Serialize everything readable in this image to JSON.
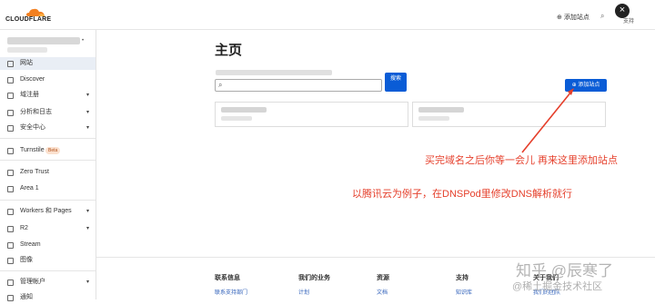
{
  "header": {
    "logo_text": "CLOUDFLARE",
    "add_site_label": "添加站点",
    "search_icon": "search-icon",
    "support_label": "支持",
    "close_icon": "close-icon"
  },
  "sidebar": {
    "items": [
      {
        "label": "网站",
        "icon": "website-icon",
        "caret": "",
        "active": true
      },
      {
        "label": "Discover",
        "icon": "discover-icon",
        "caret": ""
      },
      {
        "label": "域注册",
        "icon": "globe-icon",
        "caret": "▾"
      },
      {
        "label": "分析和日志",
        "icon": "analytics-icon",
        "caret": "▾"
      },
      {
        "label": "安全中心",
        "icon": "shield-icon",
        "caret": "▾"
      },
      {
        "label": "Turnstile",
        "icon": "turnstile-icon",
        "caret": "",
        "badge": "Beta"
      },
      {
        "label": "Zero Trust",
        "icon": "zero-trust-icon",
        "caret": ""
      },
      {
        "label": "Area 1",
        "icon": "area1-icon",
        "caret": ""
      },
      {
        "label": "Workers 和 Pages",
        "icon": "workers-icon",
        "caret": "▾"
      },
      {
        "label": "R2",
        "icon": "r2-icon",
        "caret": "▾"
      },
      {
        "label": "Stream",
        "icon": "stream-icon",
        "caret": ""
      },
      {
        "label": "图像",
        "icon": "images-icon",
        "caret": ""
      },
      {
        "label": "管理帐户",
        "icon": "settings-icon",
        "caret": "▾"
      },
      {
        "label": "通知",
        "icon": "bell-icon",
        "caret": ""
      }
    ]
  },
  "main": {
    "title": "主页",
    "search_button": "搜索",
    "add_site_button": "添加站点"
  },
  "annotations": {
    "line1": "买完域名之后你等一会儿 再来这里添加站点",
    "line2": "以腾讯云为例子，在DNSPod里修改DNS解析就行"
  },
  "footer": {
    "columns": [
      {
        "heading": "联系信息",
        "link": "联系支持部门"
      },
      {
        "heading": "我们的业务",
        "link": "计划"
      },
      {
        "heading": "资源",
        "link": "文档"
      },
      {
        "heading": "支持",
        "link": "知识库"
      },
      {
        "heading": "关于我们",
        "link": "我们的团队"
      }
    ]
  },
  "watermark": {
    "line1": "知乎 @辰寒了",
    "line2": "@稀土掘金技术社区"
  },
  "colors": {
    "accent": "#0a5cd6",
    "annotation": "#e53f2b",
    "logo_orange": "#f38020"
  }
}
